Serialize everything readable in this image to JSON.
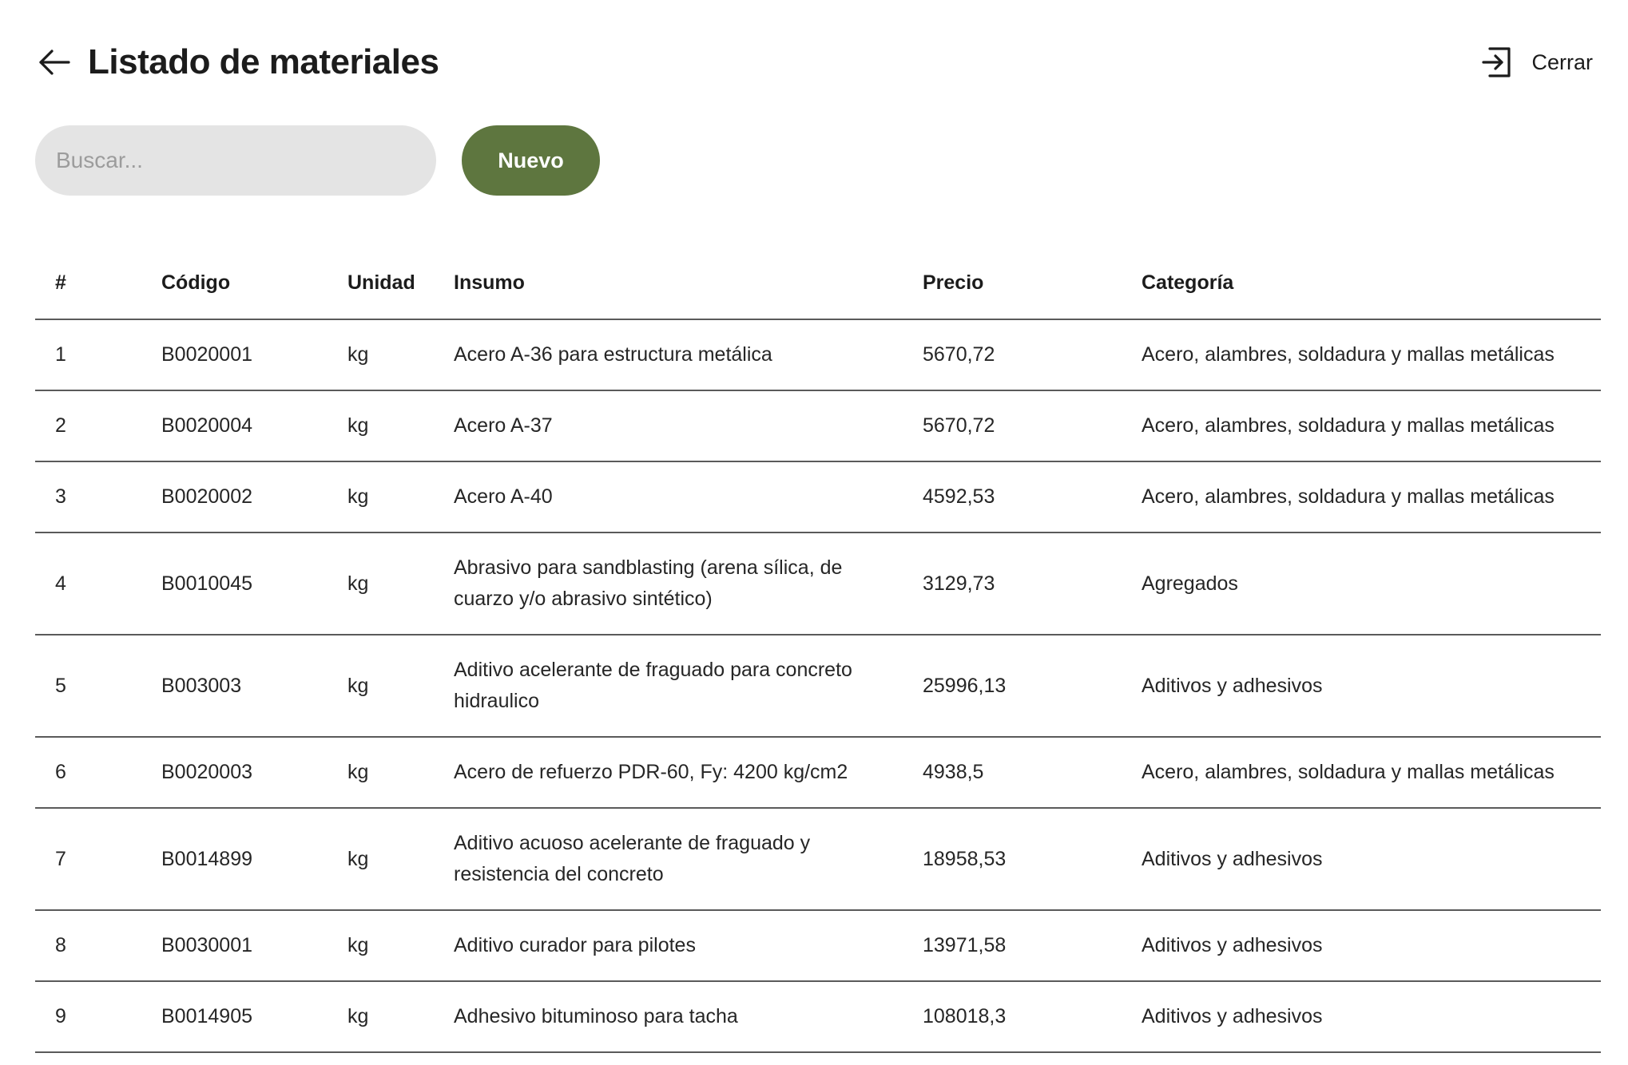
{
  "header": {
    "title": "Listado de materiales",
    "close_label": "Cerrar"
  },
  "toolbar": {
    "search_placeholder": "Buscar...",
    "search_value": "",
    "new_label": "Nuevo"
  },
  "colors": {
    "accent": "#5e763f",
    "input_bg": "#e4e4e4",
    "divider": "#5a5a5a"
  },
  "icons": {
    "back": "arrow-left-icon",
    "close": "sign-out-icon"
  },
  "table": {
    "columns": [
      "#",
      "Código",
      "Unidad",
      "Insumo",
      "Precio",
      "Categoría"
    ],
    "rows": [
      {
        "num": "1",
        "code": "B0020001",
        "unit": "kg",
        "insumo": "Acero A-36 para estructura metálica",
        "price": "5670,72",
        "category": "Acero, alambres, soldadura y mallas metálicas"
      },
      {
        "num": "2",
        "code": "B0020004",
        "unit": "kg",
        "insumo": "Acero A-37",
        "price": "5670,72",
        "category": "Acero, alambres, soldadura y mallas metálicas"
      },
      {
        "num": "3",
        "code": "B0020002",
        "unit": "kg",
        "insumo": "Acero A-40",
        "price": "4592,53",
        "category": "Acero, alambres, soldadura y mallas metálicas"
      },
      {
        "num": "4",
        "code": "B0010045",
        "unit": "kg",
        "insumo": "Abrasivo para sandblasting (arena sílica, de cuarzo y/o abrasivo sintético)",
        "price": "3129,73",
        "category": "Agregados"
      },
      {
        "num": "5",
        "code": "B003003",
        "unit": "kg",
        "insumo": "Aditivo acelerante de fraguado para concreto hidraulico",
        "price": "25996,13",
        "category": "Aditivos y adhesivos"
      },
      {
        "num": "6",
        "code": "B0020003",
        "unit": "kg",
        "insumo": "Acero de refuerzo PDR-60, Fy: 4200 kg/cm2",
        "price": "4938,5",
        "category": "Acero, alambres, soldadura y mallas metálicas"
      },
      {
        "num": "7",
        "code": "B0014899",
        "unit": "kg",
        "insumo": "Aditivo acuoso acelerante de fraguado y resistencia del concreto",
        "price": "18958,53",
        "category": "Aditivos y adhesivos"
      },
      {
        "num": "8",
        "code": "B0030001",
        "unit": "kg",
        "insumo": "Aditivo curador para pilotes",
        "price": "13971,58",
        "category": "Aditivos y adhesivos"
      },
      {
        "num": "9",
        "code": "B0014905",
        "unit": "kg",
        "insumo": "Adhesivo bituminoso para tacha",
        "price": "108018,3",
        "category": "Aditivos y adhesivos"
      }
    ]
  }
}
